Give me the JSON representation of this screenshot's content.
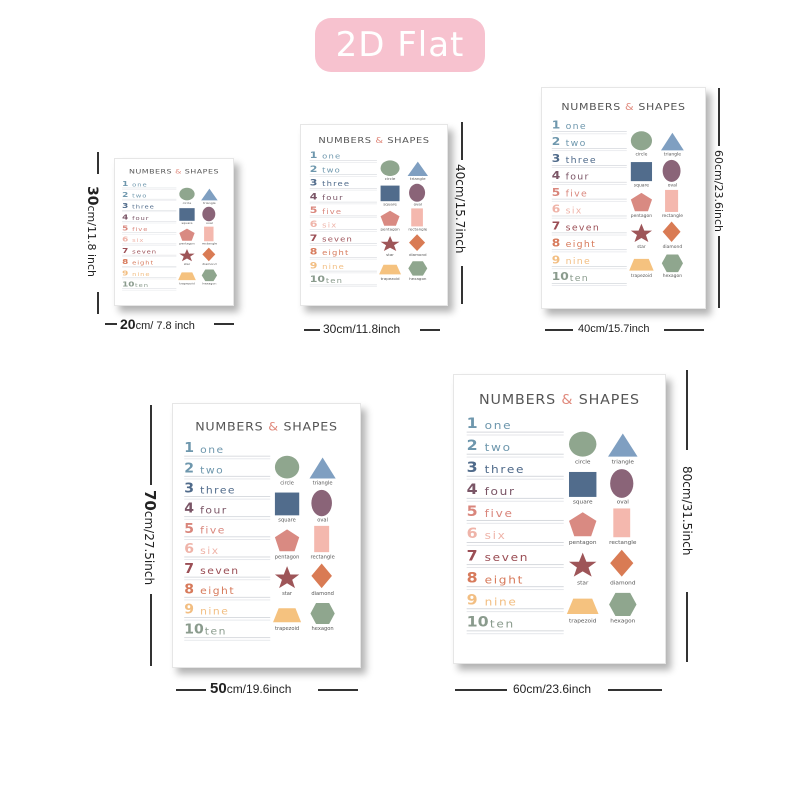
{
  "banner": {
    "text": "2D Flat",
    "color": "#f7c2cf"
  },
  "poster": {
    "title_left": "NUMBERS",
    "title_amp": "&",
    "title_right": "SHAPES",
    "numbers": [
      {
        "digit": "1",
        "word": "one",
        "color": "#6e97ad"
      },
      {
        "digit": "2",
        "word": "two",
        "color": "#6e97ad"
      },
      {
        "digit": "3",
        "word": "three",
        "color": "#4f6a8a"
      },
      {
        "digit": "4",
        "word": "four",
        "color": "#7a5566"
      },
      {
        "digit": "5",
        "word": "five",
        "color": "#d9867c"
      },
      {
        "digit": "6",
        "word": "six",
        "color": "#efb4a9"
      },
      {
        "digit": "7",
        "word": "seven",
        "color": "#9b4e55"
      },
      {
        "digit": "8",
        "word": "eight",
        "color": "#d77a5b"
      },
      {
        "digit": "9",
        "word": "nine",
        "color": "#f2be82"
      },
      {
        "digit": "10",
        "word": "ten",
        "color": "#8a9b8d"
      }
    ],
    "shapes": [
      {
        "name": "circle",
        "label": "circle",
        "color": "#8fa68e"
      },
      {
        "name": "triangle",
        "label": "triangle",
        "color": "#7f9fc1"
      },
      {
        "name": "square",
        "label": "square",
        "color": "#516c8c"
      },
      {
        "name": "oval",
        "label": "oval",
        "color": "#8a6478"
      },
      {
        "name": "pentagon",
        "label": "pentagon",
        "color": "#d98a82"
      },
      {
        "name": "rectangle",
        "label": "rectangle",
        "color": "#f4b8ae"
      },
      {
        "name": "star",
        "label": "star",
        "color": "#9e5558"
      },
      {
        "name": "diamond",
        "label": "diamond",
        "color": "#d97b54"
      },
      {
        "name": "trapezoid",
        "label": "trapezoid",
        "color": "#f5c27f"
      },
      {
        "name": "hexagon",
        "label": "hexagon",
        "color": "#8fa68e"
      }
    ]
  },
  "sizes": [
    {
      "width_big": "20",
      "width_small": "cm/ 7.8 inch",
      "height_big": "30",
      "height_small": "cm/11.8 inch"
    },
    {
      "width_big": "30cm/11.8inch",
      "width_small": "",
      "height_big": "40cm/15.7inch",
      "height_small": ""
    },
    {
      "width_big": "40cm/15.7inch",
      "width_small": "",
      "height_big": "60cm/23.6inch",
      "height_small": ""
    },
    {
      "width_big": "50",
      "width_small": "cm/19.6inch",
      "height_big": "70",
      "height_small": "cm/27.5inch"
    },
    {
      "width_big": "60cm/23.6inch",
      "width_small": "",
      "height_big": "80cm/31.5inch",
      "height_small": ""
    }
  ]
}
